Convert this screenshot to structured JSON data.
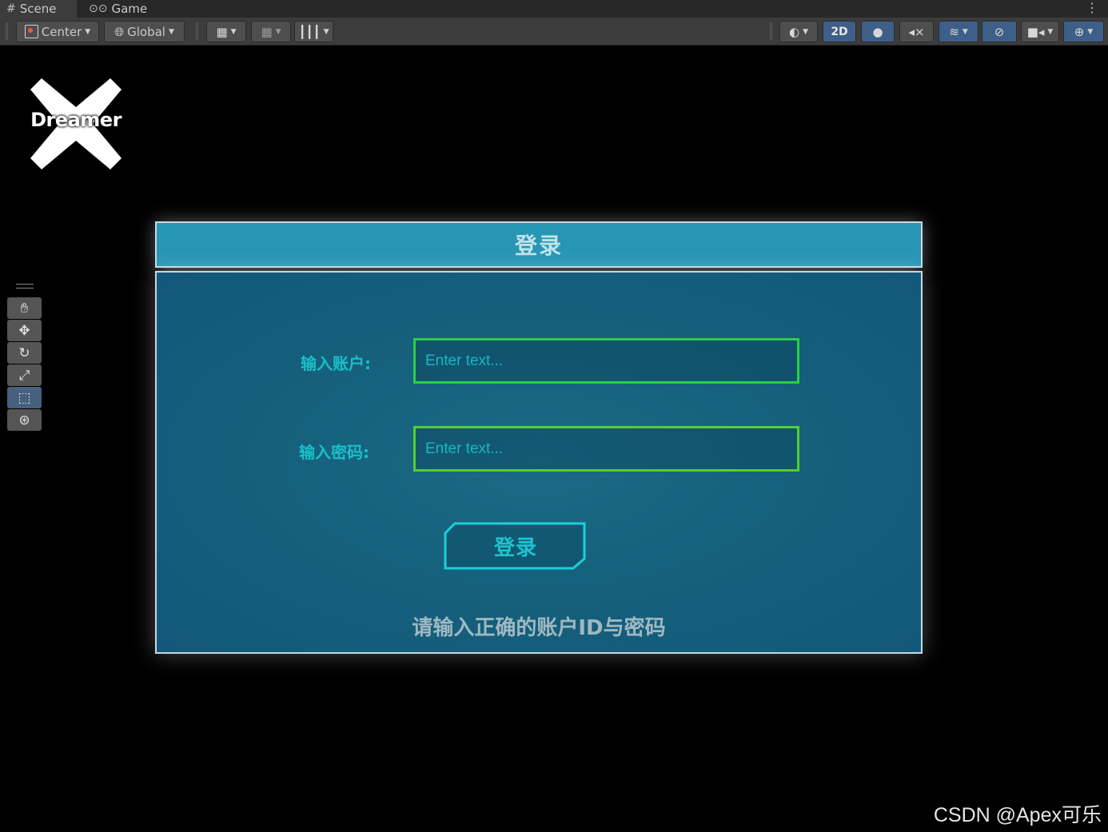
{
  "tabs": [
    {
      "label": "Scene",
      "icon": "grid-icon",
      "active": true
    },
    {
      "label": "Game",
      "icon": "gamepad-icon",
      "active": false
    }
  ],
  "toolbar": {
    "pivot_label": "Center",
    "space_label": "Global",
    "mode_2d_label": "2D"
  },
  "logo": {
    "text": "Dreamer"
  },
  "login": {
    "title": "登录",
    "account_label": "输入账户:",
    "account_placeholder": "Enter text...",
    "password_label": "输入密码:",
    "password_placeholder": "Enter text...",
    "button_label": "登录",
    "hint": "请输入正确的账户ID与密码"
  },
  "watermark": "CSDN @Apex可乐",
  "colors": {
    "title_bar": "#2796b4",
    "panel": "#155f7b",
    "field_border": "#2bcf43",
    "accent_text": "#18c0c9"
  }
}
